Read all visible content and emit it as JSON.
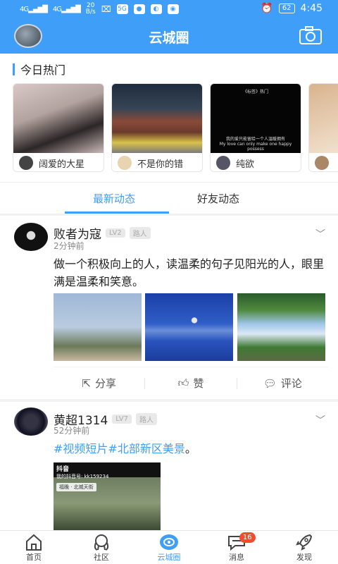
{
  "status_bar": {
    "net_speed_top": "20",
    "net_speed_unit": "B/s",
    "battery": "62",
    "time": "4:45",
    "signal1": "4G",
    "signal2": "4G",
    "app_badge": "5G"
  },
  "header": {
    "title": "云城圈"
  },
  "hot": {
    "title": "今日热门",
    "cards": [
      {
        "name": "阔爱的大星"
      },
      {
        "name": "不是你的错"
      },
      {
        "name": "纯欲",
        "video_caption": "《标签》热门",
        "video_subtitle": "我的爱只能留给一个人温暖拥有",
        "video_subtitle_en": "My love can only make one happy possess"
      },
      {
        "name": ""
      }
    ]
  },
  "tabs": [
    {
      "label": "最新动态"
    },
    {
      "label": "好友动态"
    }
  ],
  "posts": [
    {
      "author": "败者为寇",
      "level": "LV2",
      "role": "路人",
      "time": "2分钟前",
      "text": "做一个积极向上的人，读温柔的句子见阳光的人，眼里满是温柔和笑意。",
      "actions": {
        "share": "分享",
        "like": "赞",
        "comment": "评论"
      }
    },
    {
      "author": "黄超1314",
      "level": "LV7",
      "role": "路人",
      "time": "52分钟前",
      "tag1": "#视频短片",
      "tag2": "#北部新区美景",
      "tail": "。",
      "video": {
        "app": "抖音",
        "account": "我的抖音号: kk159234",
        "location": "福晚 · 北城天街"
      }
    }
  ],
  "nav": [
    {
      "label": "首页"
    },
    {
      "label": "社区"
    },
    {
      "label": "云城圈"
    },
    {
      "label": "消息",
      "badge": "16"
    },
    {
      "label": "发现"
    }
  ],
  "colors": {
    "accent": "#3f9ef7",
    "badge": "#f24b2f"
  }
}
